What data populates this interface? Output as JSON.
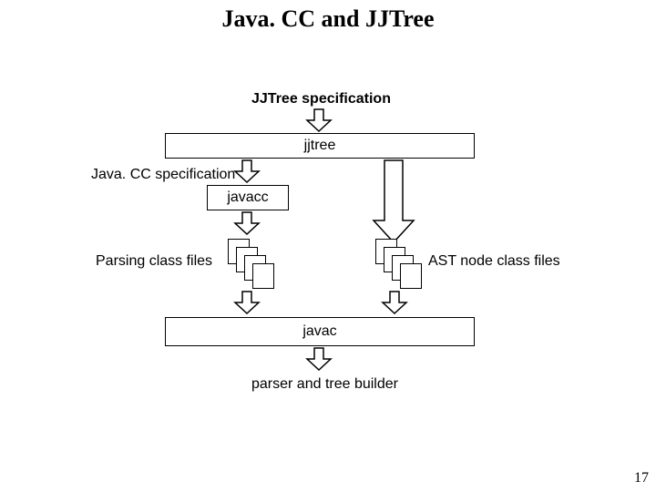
{
  "title": "Java. CC and JJTree",
  "pagenum": "17",
  "labels": {
    "jjtree_spec": "JJTree specification",
    "javacc_spec": "Java. CC specification",
    "parsing_files": "Parsing class files",
    "ast_files": "AST node class files",
    "parser_builder": "parser and tree builder"
  },
  "boxes": {
    "jjtree": "jjtree",
    "javacc": "javacc",
    "javac": "javac"
  }
}
